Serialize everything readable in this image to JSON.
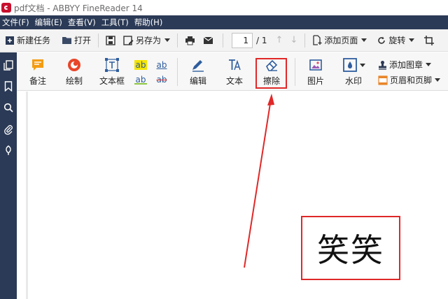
{
  "window": {
    "title": "pdf文档 - ABBYY FineReader 14"
  },
  "menu": [
    "文件(F)",
    "编辑(E)",
    "查看(V)",
    "工具(T)",
    "帮助(H)"
  ],
  "toolbar": {
    "new_task": "新建任务",
    "open": "打开",
    "save_as": "另存为",
    "page_current": "1",
    "page_total": "/ 1",
    "add_page": "添加页面",
    "rotate": "旋转"
  },
  "ribbon": {
    "note": "备注",
    "draw": "绘制",
    "textbox": "文本框",
    "ab": "ab",
    "edit": "编辑",
    "text": "文本",
    "erase": "擦除",
    "picture": "图片",
    "watermark": "水印",
    "add_stamp": "添加图章",
    "header_footer": "页眉和页脚"
  },
  "document": {
    "text": "笑笑"
  },
  "colors": {
    "menubar": "#2b3a56",
    "sidebar": "#2b3a56",
    "annotation": "#e02828",
    "note_icon": "#f39c12",
    "draw_icon": "#e8462a",
    "ribbon_blue": "#2e5d9e"
  }
}
